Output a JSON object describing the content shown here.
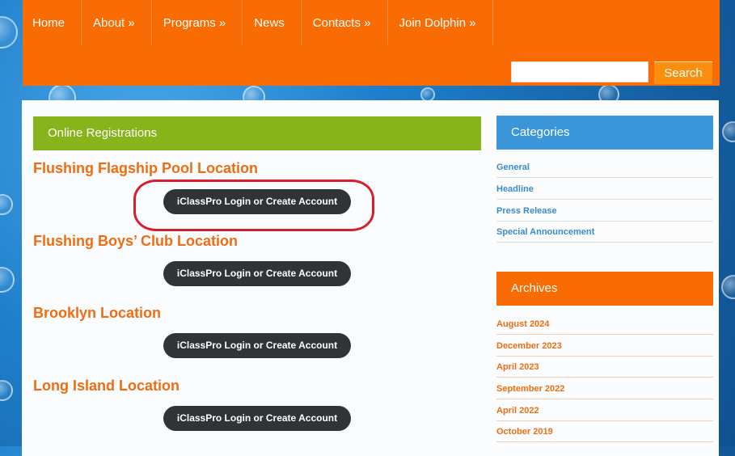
{
  "nav": {
    "items": [
      {
        "label": "Home"
      },
      {
        "label": "About »"
      },
      {
        "label": "Programs »"
      },
      {
        "label": "News"
      },
      {
        "label": "Contacts »"
      },
      {
        "label": "Join Dolphin »"
      }
    ]
  },
  "search": {
    "placeholder": "",
    "value": "",
    "button_label": "Search"
  },
  "main": {
    "bar_title": "Online Registrations",
    "locations": [
      {
        "title": "Flushing Flagship Pool Location",
        "button": "iClassPro Login or Create Account"
      },
      {
        "title": "Flushing Boys’ Club Location",
        "button": "iClassPro Login or Create Account"
      },
      {
        "title": "Brooklyn Location",
        "button": "iClassPro Login or Create Account"
      },
      {
        "title": "Long Island Location",
        "button": "iClassPro Login or Create Account"
      }
    ]
  },
  "sidebar": {
    "categories_title": "Categories",
    "categories": [
      "General",
      "Headline",
      "Press Release",
      "Special Announcement"
    ],
    "archives_title": "Archives",
    "archives": [
      "August 2024",
      "December 2023",
      "April 2023",
      "September 2022",
      "April 2022",
      "October 2019"
    ]
  },
  "colors": {
    "header": "#f96c04",
    "main_bar": "#86b41a",
    "categories_bar": "#3a96d9",
    "archives_bar": "#f96c04",
    "button": "#303338",
    "highlight": "#d71f2b"
  }
}
